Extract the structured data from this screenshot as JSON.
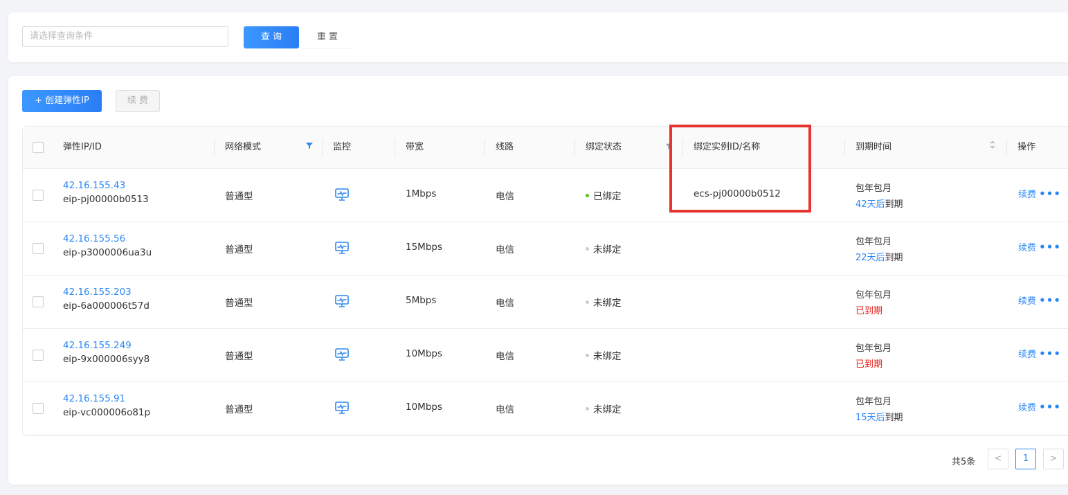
{
  "search": {
    "placeholder": "请选择查询条件",
    "query_label": "查 询",
    "reset_label": "重 置"
  },
  "toolbar": {
    "create_label": "+ 创建弹性IP",
    "renew_label": "续 费"
  },
  "table": {
    "headers": {
      "ip": "弹性IP/ID",
      "mode": "网络模式",
      "monitor": "监控",
      "bandwidth": "带宽",
      "line": "线路",
      "bind_status": "绑定状态",
      "instance": "绑定实例ID/名称",
      "expiry": "到期时间",
      "action": "操作"
    },
    "rows": [
      {
        "ip": "42.16.155.43",
        "id": "eip-pj00000b0513",
        "mode": "普通型",
        "bandwidth": "1Mbps",
        "line": "电信",
        "status": "已绑定",
        "status_color": "#52c41a",
        "instance": "ecs-pj00000b0512",
        "billing": "包年包月",
        "days": "42天后",
        "suffix": "到期",
        "expired": ""
      },
      {
        "ip": "42.16.155.56",
        "id": "eip-p3000006ua3u",
        "mode": "普通型",
        "bandwidth": "15Mbps",
        "line": "电信",
        "status": "未绑定",
        "status_color": "#cccccc",
        "instance": "",
        "billing": "包年包月",
        "days": "22天后",
        "suffix": "到期",
        "expired": ""
      },
      {
        "ip": "42.16.155.203",
        "id": "eip-6a000006t57d",
        "mode": "普通型",
        "bandwidth": "5Mbps",
        "line": "电信",
        "status": "未绑定",
        "status_color": "#cccccc",
        "instance": "",
        "billing": "包年包月",
        "days": "",
        "suffix": "",
        "expired": "已到期"
      },
      {
        "ip": "42.16.155.249",
        "id": "eip-9x000006syy8",
        "mode": "普通型",
        "bandwidth": "10Mbps",
        "line": "电信",
        "status": "未绑定",
        "status_color": "#cccccc",
        "instance": "",
        "billing": "包年包月",
        "days": "",
        "suffix": "",
        "expired": "已到期"
      },
      {
        "ip": "42.16.155.91",
        "id": "eip-vc000006o81p",
        "mode": "普通型",
        "bandwidth": "10Mbps",
        "line": "电信",
        "status": "未绑定",
        "status_color": "#cccccc",
        "instance": "",
        "billing": "包年包月",
        "days": "15天后",
        "suffix": "到期",
        "expired": ""
      }
    ],
    "row_action": "续费",
    "more": "•••"
  },
  "pagination": {
    "total": "共5条",
    "current": "1",
    "prev": "<",
    "next": ">"
  },
  "colors": {
    "primary": "#2b87f2",
    "danger": "#e8221e",
    "highlight": "#e8342e"
  }
}
